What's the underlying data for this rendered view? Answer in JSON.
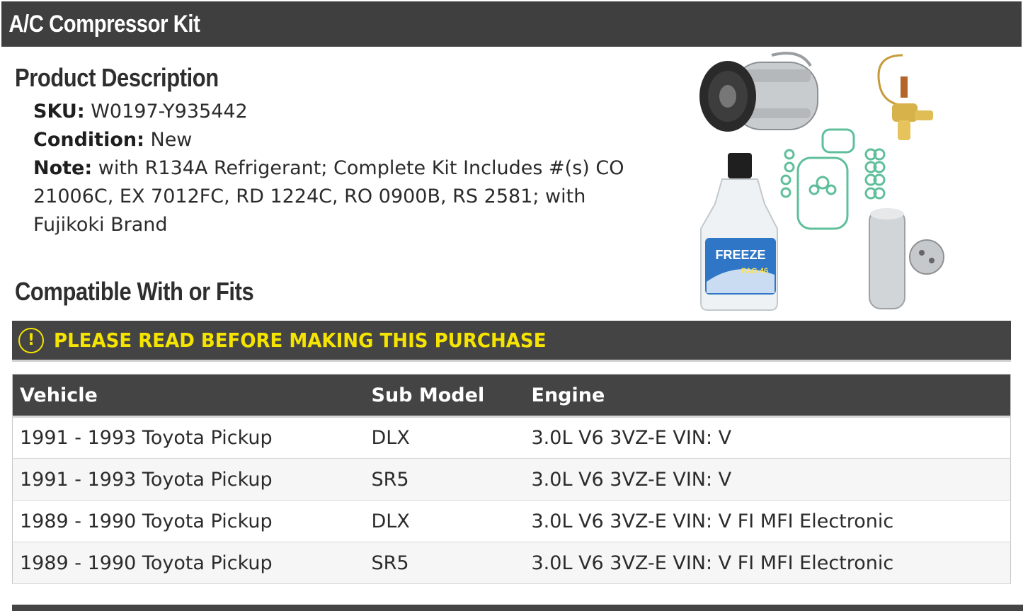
{
  "header": {
    "title": "A/C Compressor Kit"
  },
  "product_description": {
    "heading": "Product Description",
    "sku_label": "SKU:",
    "sku_value": "W0197-Y935442",
    "condition_label": "Condition:",
    "condition_value": "New",
    "note_label": "Note:",
    "note_value": "with R134A Refrigerant; Complete Kit Includes #(s) CO 21006C, EX 7012FC, RD 1224C, RO 0900B, RS 2581; with Fujikoki Brand"
  },
  "compatibility": {
    "heading": "Compatible With or Fits",
    "warning_icon": "exclamation-circle-icon",
    "warning_text": "PLEASE READ BEFORE MAKING THIS PURCHASE",
    "warning_color": "#f5e400",
    "columns": {
      "vehicle": "Vehicle",
      "sub_model": "Sub Model",
      "engine": "Engine"
    },
    "rows": [
      {
        "vehicle": "1991 - 1993 Toyota Pickup",
        "sub_model": "DLX",
        "engine": "3.0L V6 3VZ-E VIN: V"
      },
      {
        "vehicle": "1991 - 1993 Toyota Pickup",
        "sub_model": "SR5",
        "engine": "3.0L V6 3VZ-E VIN: V"
      },
      {
        "vehicle": "1989 - 1990 Toyota Pickup",
        "sub_model": "DLX",
        "engine": "3.0L V6 3VZ-E VIN: V FI MFI Electronic"
      },
      {
        "vehicle": "1989 - 1990 Toyota Pickup",
        "sub_model": "SR5",
        "engine": "3.0L V6 3VZ-E VIN: V FI MFI Electronic"
      }
    ]
  },
  "product_image": {
    "bottle_label": "FREEZE",
    "bottle_sublabel": "PAG 46"
  },
  "colors": {
    "header_bg": "#3f3f3f",
    "text": "#2b2b2b"
  }
}
